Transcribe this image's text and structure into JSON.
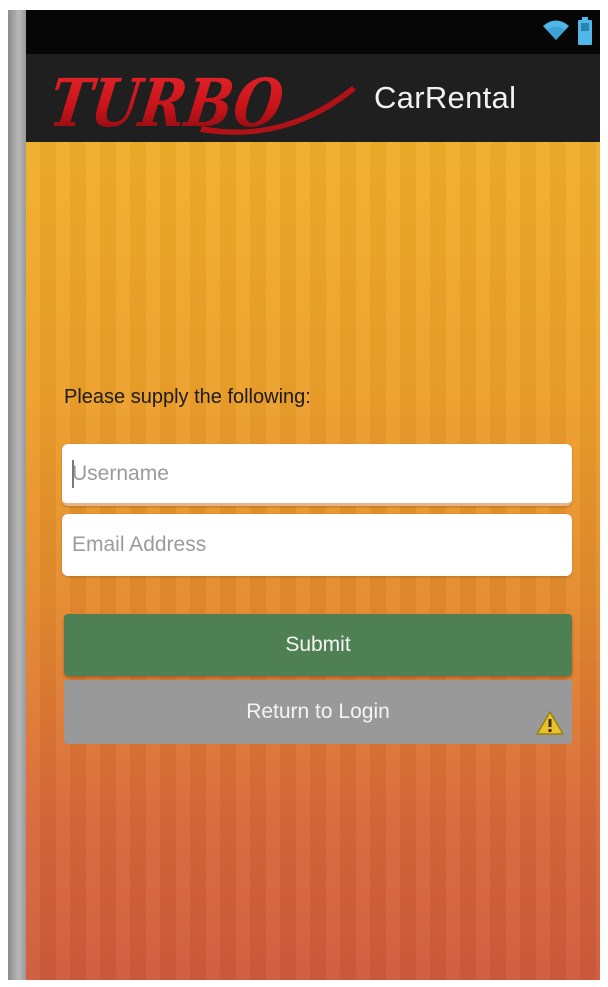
{
  "colors": {
    "status_bar": "#060606",
    "app_bar": "#1f1f1f",
    "background_top": "#f0ae2a",
    "background_bottom": "#cf5a3c",
    "submit_button": "#4e8053",
    "return_button": "#999999",
    "logo_red": "#c8141a"
  },
  "status_bar": {
    "icons": [
      "wifi-icon",
      "battery-icon"
    ]
  },
  "app_bar": {
    "logo_text": "TURBO",
    "title": "CarRental"
  },
  "form": {
    "prompt": "Please supply the following:",
    "username": {
      "placeholder": "Username",
      "value": ""
    },
    "email": {
      "placeholder": "Email Address",
      "value": ""
    }
  },
  "buttons": {
    "submit_label": "Submit",
    "return_label": "Return to Login",
    "return_icon": "warning-icon"
  }
}
